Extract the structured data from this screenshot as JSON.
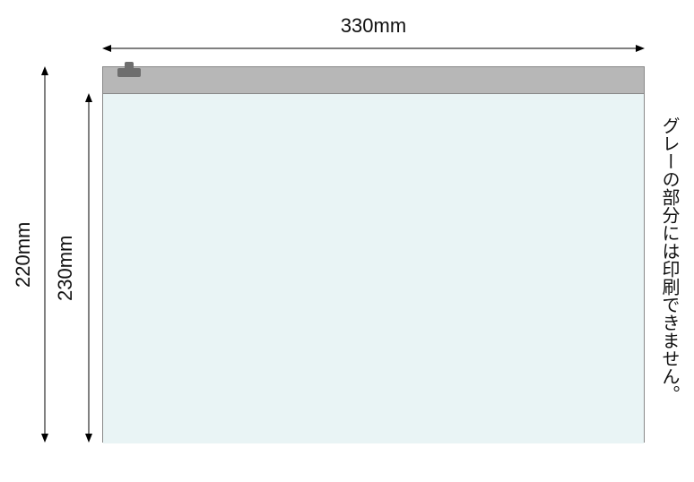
{
  "dimensions": {
    "width_label": "330mm",
    "height_label_outer": "220mm",
    "height_label_inner": "230mm"
  },
  "note": "グレーの部分には印刷できません。"
}
